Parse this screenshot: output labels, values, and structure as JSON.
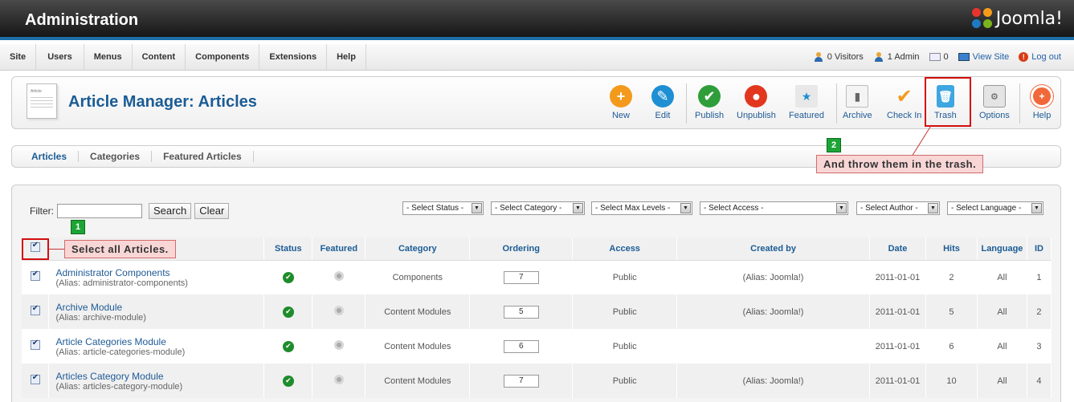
{
  "header": {
    "title": "Administration",
    "logo_text": "Joomla!"
  },
  "menu": {
    "items": [
      "Site",
      "Users",
      "Menus",
      "Content",
      "Components",
      "Extensions",
      "Help"
    ]
  },
  "status": {
    "visitors": "0 Visitors",
    "admins": "1 Admin",
    "messages": "0",
    "view_site": "View Site",
    "logout": "Log out"
  },
  "toolbar": {
    "page_title": "Article Manager: Articles",
    "buttons": {
      "new": "New",
      "edit": "Edit",
      "publish": "Publish",
      "unpublish": "Unpublish",
      "featured": "Featured",
      "archive": "Archive",
      "checkin": "Check In",
      "trash": "Trash",
      "options": "Options",
      "help": "Help"
    }
  },
  "tabs": [
    "Articles",
    "Categories",
    "Featured Articles"
  ],
  "callouts": {
    "one": {
      "number": "1",
      "text": "Select all Articles."
    },
    "two": {
      "number": "2",
      "text": "And throw them in the trash."
    }
  },
  "filter": {
    "label": "Filter:",
    "search_value": "",
    "search_button": "Search",
    "clear_button": "Clear",
    "selects": {
      "status": "- Select Status -",
      "category": "- Select Category -",
      "max_levels": "- Select Max Levels -",
      "access": "- Select Access -",
      "author": "- Select Author -",
      "language": "- Select Language -"
    }
  },
  "table": {
    "headers": {
      "status": "Status",
      "featured": "Featured",
      "category": "Category",
      "ordering": "Ordering",
      "access": "Access",
      "created_by": "Created by",
      "date": "Date",
      "hits": "Hits",
      "language": "Language",
      "id": "ID"
    },
    "rows": [
      {
        "title": "Administrator Components",
        "alias": "(Alias: administrator-components)",
        "category": "Components",
        "ordering": "7",
        "access": "Public",
        "created_by": "(Alias: Joomla!)",
        "date": "2011-01-01",
        "hits": "2",
        "language": "All",
        "id": "1"
      },
      {
        "title": "Archive Module",
        "alias": "(Alias: archive-module)",
        "category": "Content Modules",
        "ordering": "5",
        "access": "Public",
        "created_by": "(Alias: Joomla!)",
        "date": "2011-01-01",
        "hits": "5",
        "language": "All",
        "id": "2"
      },
      {
        "title": "Article Categories Module",
        "alias": "(Alias: article-categories-module)",
        "category": "Content Modules",
        "ordering": "6",
        "access": "Public",
        "created_by": "",
        "date": "2011-01-01",
        "hits": "6",
        "language": "All",
        "id": "3"
      },
      {
        "title": "Articles Category Module",
        "alias": "(Alias: articles-category-module)",
        "category": "Content Modules",
        "ordering": "7",
        "access": "Public",
        "created_by": "(Alias: Joomla!)",
        "date": "2011-01-01",
        "hits": "10",
        "language": "All",
        "id": "4"
      }
    ]
  },
  "colors": {
    "header_blue": "#1b5c95",
    "highlight_red": "#d20f0f",
    "callout_pink": "#f9d6d6",
    "badge_green": "#1ca536"
  }
}
